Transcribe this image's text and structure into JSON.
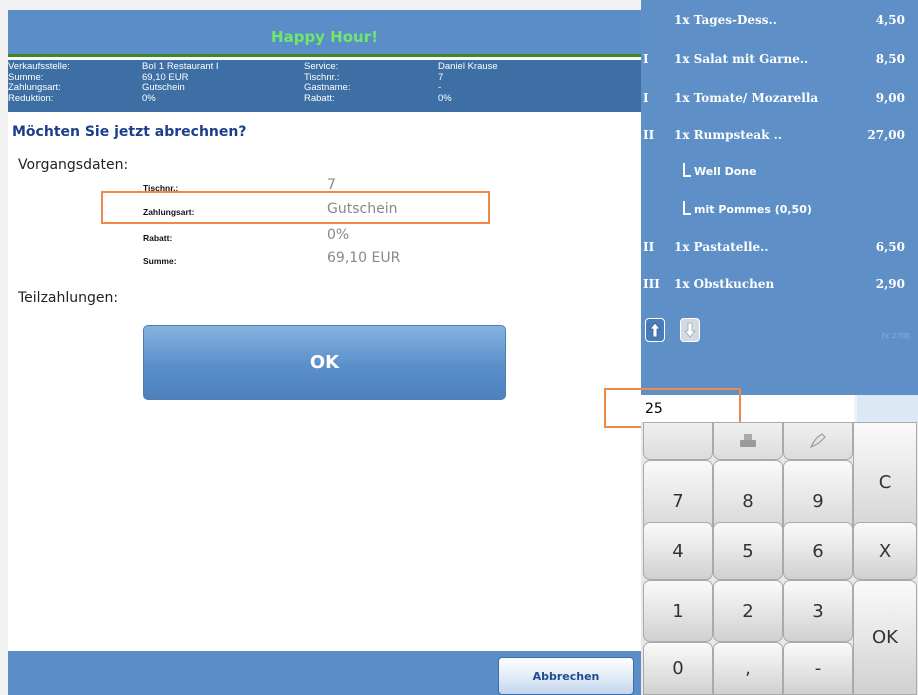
{
  "header": {
    "title": "Happy Hour!"
  },
  "info": {
    "col1": [
      "Verkaufsstelle:",
      "Summe:",
      "Zahlungsart:",
      "Reduktion:"
    ],
    "col2": [
      "BoI 1 Restaurant I",
      "69,10 EUR",
      "Gutschein",
      "0%"
    ],
    "col3": [
      "Service:",
      "Tischnr.:",
      "Gastname:",
      "Rabatt:"
    ],
    "col4": [
      "Daniel Krause",
      "7",
      "-",
      "0%"
    ]
  },
  "dialog": {
    "question": "Möchten Sie jetzt abrechnen?",
    "vorgang_label": "Vorgangsdaten:",
    "rows": [
      {
        "label": "Tischnr.:",
        "value": "7"
      },
      {
        "label": "Zahlungsart:",
        "value": "Gutschein"
      },
      {
        "label": "Rabatt:",
        "value": "0%"
      },
      {
        "label": "Summe:",
        "value": "69,10 EUR"
      }
    ],
    "teil_label": "Teilzahlungen:",
    "ok_label": "OK",
    "cancel_label": "Abbrechen"
  },
  "orders": [
    {
      "course": "",
      "name": "1x Tages-Dess..",
      "price": "4,50"
    },
    {
      "course": "I",
      "name": "1x Salat mit Garne..",
      "price": "8,50"
    },
    {
      "course": "I",
      "name": "1x Tomate/ Mozarella",
      "price": "9,00"
    },
    {
      "course": "II",
      "name": "1x Rumpsteak ..",
      "price": "27,00"
    },
    {
      "course": "",
      "name": "Well Done",
      "price": "",
      "modifier": true
    },
    {
      "course": "",
      "name": "mit Pommes (0,50)",
      "price": "",
      "modifier": true
    },
    {
      "course": "II",
      "name": "1x Pastatelle..",
      "price": "6,50"
    },
    {
      "course": "III",
      "name": "1x Obstkuchen",
      "price": "2,90"
    }
  ],
  "version": "(V. 2.70f)",
  "input": {
    "value": "25"
  },
  "keypad": {
    "digits": [
      "7",
      "8",
      "9",
      "4",
      "5",
      "6",
      "1",
      "2",
      "3",
      "0",
      ",",
      "-"
    ],
    "clear": "C",
    "cancel": "X",
    "ok": "OK"
  },
  "icons": {
    "up": "arrow-up-icon",
    "down": "arrow-down-icon",
    "card": "card-reader-icon",
    "sign": "sign-hand-icon"
  }
}
